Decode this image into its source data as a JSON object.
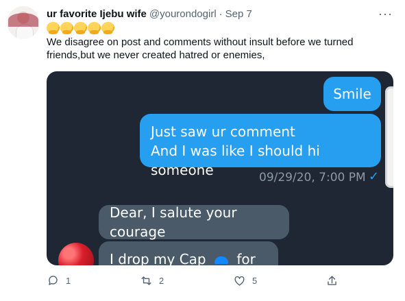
{
  "tweet": {
    "name": "ur favorite Ijebu wife",
    "handle": "@yourondogirl",
    "separator": "·",
    "date": "Sep 7",
    "more": "···",
    "emoji_icon": "hugging-face-icon",
    "body": "We disagree on post and comments without insult  before we turned friends,but we never created hatred or enemies,"
  },
  "chat": {
    "out_1": "Smile",
    "out_2": "Just saw ur comment\nAnd I was like I should hi someone",
    "timestamp": "09/29/20, 7:00 PM",
    "read_icon": "checkmark-icon",
    "in_1": "Dear, I salute your courage",
    "in_2_start": "I drop my Cap",
    "in_2_end": "for you"
  },
  "actions": {
    "reply_count": "1",
    "retweet_count": "2",
    "like_count": "5"
  }
}
